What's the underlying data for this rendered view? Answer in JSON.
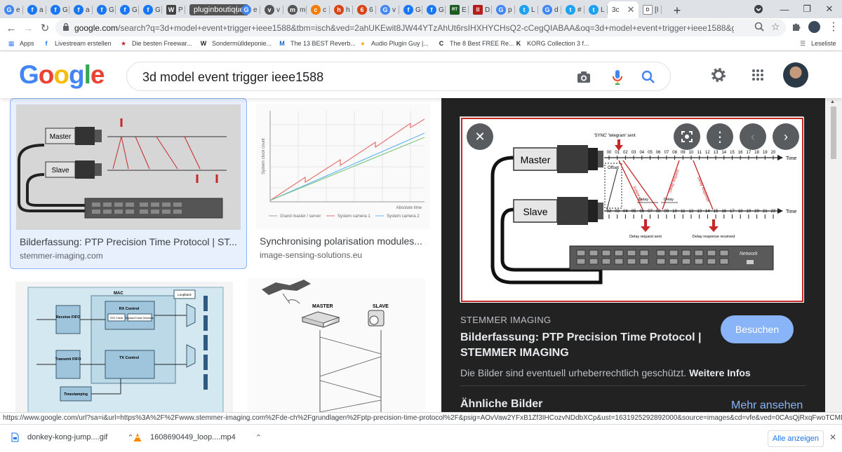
{
  "browser": {
    "tabs": [
      {
        "icon": "google-icon",
        "label": "G",
        "title": "e",
        "color": "#4285f4"
      },
      {
        "icon": "facebook-icon",
        "label": "f",
        "title": "a",
        "color": "#1877f2"
      },
      {
        "icon": "facebook-icon",
        "label": "f",
        "title": "G",
        "color": "#1877f2"
      },
      {
        "icon": "facebook-icon",
        "label": "f",
        "title": "a",
        "color": "#1877f2"
      },
      {
        "icon": "facebook-icon",
        "label": "f",
        "title": "G",
        "color": "#1877f2"
      },
      {
        "icon": "facebook-icon",
        "label": "f",
        "title": "G",
        "color": "#1877f2"
      },
      {
        "icon": "facebook-icon",
        "label": "f",
        "title": "G",
        "color": "#1877f2"
      },
      {
        "icon": "wikipedia-icon",
        "label": "W",
        "title": "P",
        "color": "#444444"
      }
    ],
    "dark_tab_label": "pluginboutique",
    "tabs_right": [
      {
        "icon": "google-icon",
        "label": "G",
        "title": "e",
        "color": "#4285f4"
      },
      {
        "icon": "vimeo-icon",
        "label": "v",
        "title": "v",
        "color": "#555555"
      },
      {
        "icon": "globe-icon",
        "label": "m",
        "title": "m",
        "color": "#555555"
      },
      {
        "icon": "blogger-icon",
        "label": "c",
        "title": "c",
        "color": "#f57c00"
      },
      {
        "icon": "shield-icon",
        "label": "h",
        "title": "h",
        "color": "#d84315"
      },
      {
        "icon": "shield-icon",
        "label": "6",
        "title": "6",
        "color": "#d84315"
      },
      {
        "icon": "google-icon",
        "label": "G",
        "title": "v",
        "color": "#4285f4"
      },
      {
        "icon": "facebook-icon",
        "label": "f",
        "title": "G",
        "color": "#1877f2"
      },
      {
        "icon": "facebook-icon",
        "label": "f",
        "title": "G",
        "color": "#1877f2"
      },
      {
        "icon": "rt-icon",
        "label": "RT",
        "title": "E",
        "color": "#1b5e20"
      },
      {
        "icon": "barcode-icon",
        "label": "|||",
        "title": "D",
        "color": "#b71c1c"
      },
      {
        "icon": "google-icon",
        "label": "G",
        "title": "p",
        "color": "#4285f4"
      },
      {
        "icon": "twitter-icon",
        "label": "t",
        "title": "L",
        "color": "#1da1f2"
      },
      {
        "icon": "google-icon",
        "label": "G",
        "title": "d",
        "color": "#4285f4"
      },
      {
        "icon": "twitter-icon",
        "label": "t",
        "title": "#",
        "color": "#1da1f2"
      },
      {
        "icon": "twitter-icon",
        "label": "t",
        "title": "L",
        "color": "#1da1f2"
      }
    ],
    "active_tab": {
      "title": "3c"
    },
    "last_tab": {
      "title": "[I"
    },
    "url_host": "google.com",
    "url_rest": "/search?q=3d+model+event+trigger+ieee1588&tbm=isch&ved=2ahUKEwit8JW44YTzAhUt6rsIHXHYCHsQ2-cCegQIABAA&oq=3d+model+event+trigger+ieee1588&gs_lcp=CgNpbWcQA1CGm...",
    "bookmarks": [
      {
        "icon": "apps-icon",
        "label": "Apps"
      },
      {
        "icon": "facebook-icon",
        "label": "Livestream erstellen"
      },
      {
        "icon": "star-icon",
        "label": "Die besten Freewar..."
      },
      {
        "icon": "wikipedia-icon",
        "label": "Sondermülldeponie..."
      },
      {
        "icon": "m-icon",
        "label": "The 13 BEST Reverb..."
      },
      {
        "icon": "pig-icon",
        "label": "Audio Plugin Guy |..."
      },
      {
        "icon": "c-icon",
        "label": "The 8 Best FREE Re..."
      },
      {
        "icon": "korg-icon",
        "label": "KORG Collection 3 f..."
      }
    ],
    "reading_list": "Leseliste",
    "status_url": "https://www.google.com/url?sa=i&url=https%3A%2F%2Fwww.stemmer-imaging.com%2Fde-ch%2Fgrundlagen%2Fptp-precision-time-protocol%2F&psig=AOvVaw2YFxB1Zf3IHCozvNDdbXCp&ust=1631925292892000&source=images&cd=vfe&ved=0CAsQjRxqFwoTCMDu48zhhPMCFQAAAAA..."
  },
  "google": {
    "logo": "Google",
    "query": "3d model event trigger ieee1588"
  },
  "results": [
    {
      "title": "Bilderfassung: PTP Precision Time Protocol | ST...",
      "site": "stemmer-imaging.com"
    },
    {
      "title": "Synchronising polarisation modules...",
      "site": "image-sensing-solutions.eu"
    }
  ],
  "thumb1": {
    "master": "Master",
    "slave": "Slave"
  },
  "thumb2": {
    "legend": [
      "Grand master / server",
      "System camera 1",
      "System camera 2"
    ],
    "y": "System clock count",
    "x": "Absolute time"
  },
  "thumb3": {
    "mac": "MAC",
    "receive": "Receive FIFO",
    "rx": "RX Control",
    "transmit": "Transmit FIFO",
    "tx": "TX Control",
    "timestamping": "Timestamping",
    "loopback": "Loopback",
    "crc": "CRC Check",
    "payload": "Payload Frame Generator"
  },
  "thumb4": {
    "master": "MASTER",
    "slave": "SLAVE"
  },
  "preview": {
    "site": "STEMMER IMAGING",
    "title": "Bilderfassung: PTP Precision Time Protocol | STEMMER IMAGING",
    "visit": "Besuchen",
    "copyright": "Die Bilder sind eventuell urheberrechtlich geschützt.",
    "more_info": "Weitere Infos",
    "similar": "Ähnliche Bilder",
    "see_more": "Mehr ansehen",
    "figure": {
      "master": "Master",
      "slave": "Slave",
      "sync": "'SYNC' 'telegram' sent",
      "offset": "Offset",
      "followup": "Follow-up",
      "delay": "Delay",
      "delay_req": "Delay request",
      "delay_resp": "Delay response",
      "delay_req_sent": "Delay request sent",
      "delay_resp_recv": "Delay response received",
      "network": "Network",
      "time": "Time",
      "ticks_top": [
        "00",
        "01",
        "02",
        "03",
        "04",
        "05",
        "06",
        "07",
        "08",
        "09",
        "10",
        "11",
        "12",
        "13",
        "14",
        "15",
        "16",
        "17",
        "18",
        "19",
        "20"
      ],
      "ticks_bottom": [
        "02",
        "03",
        "04",
        "05",
        "06",
        "07",
        "08",
        "09",
        "10",
        "11",
        "12",
        "13",
        "14",
        "15",
        "16",
        "17",
        "18",
        "19",
        "20",
        "21",
        "22"
      ]
    }
  },
  "downloads": [
    {
      "icon": "file-icon",
      "name": "donkey-kong-jump....gif"
    },
    {
      "icon": "vlc-icon",
      "name": "1608690449_loop....mp4"
    }
  ],
  "download_all": "Alle anzeigen",
  "colors": {
    "google_blue": "#4285f4",
    "google_red": "#ea4335",
    "google_yellow": "#fbbc05",
    "google_green": "#34a853",
    "accent": "#8ab4f8"
  }
}
